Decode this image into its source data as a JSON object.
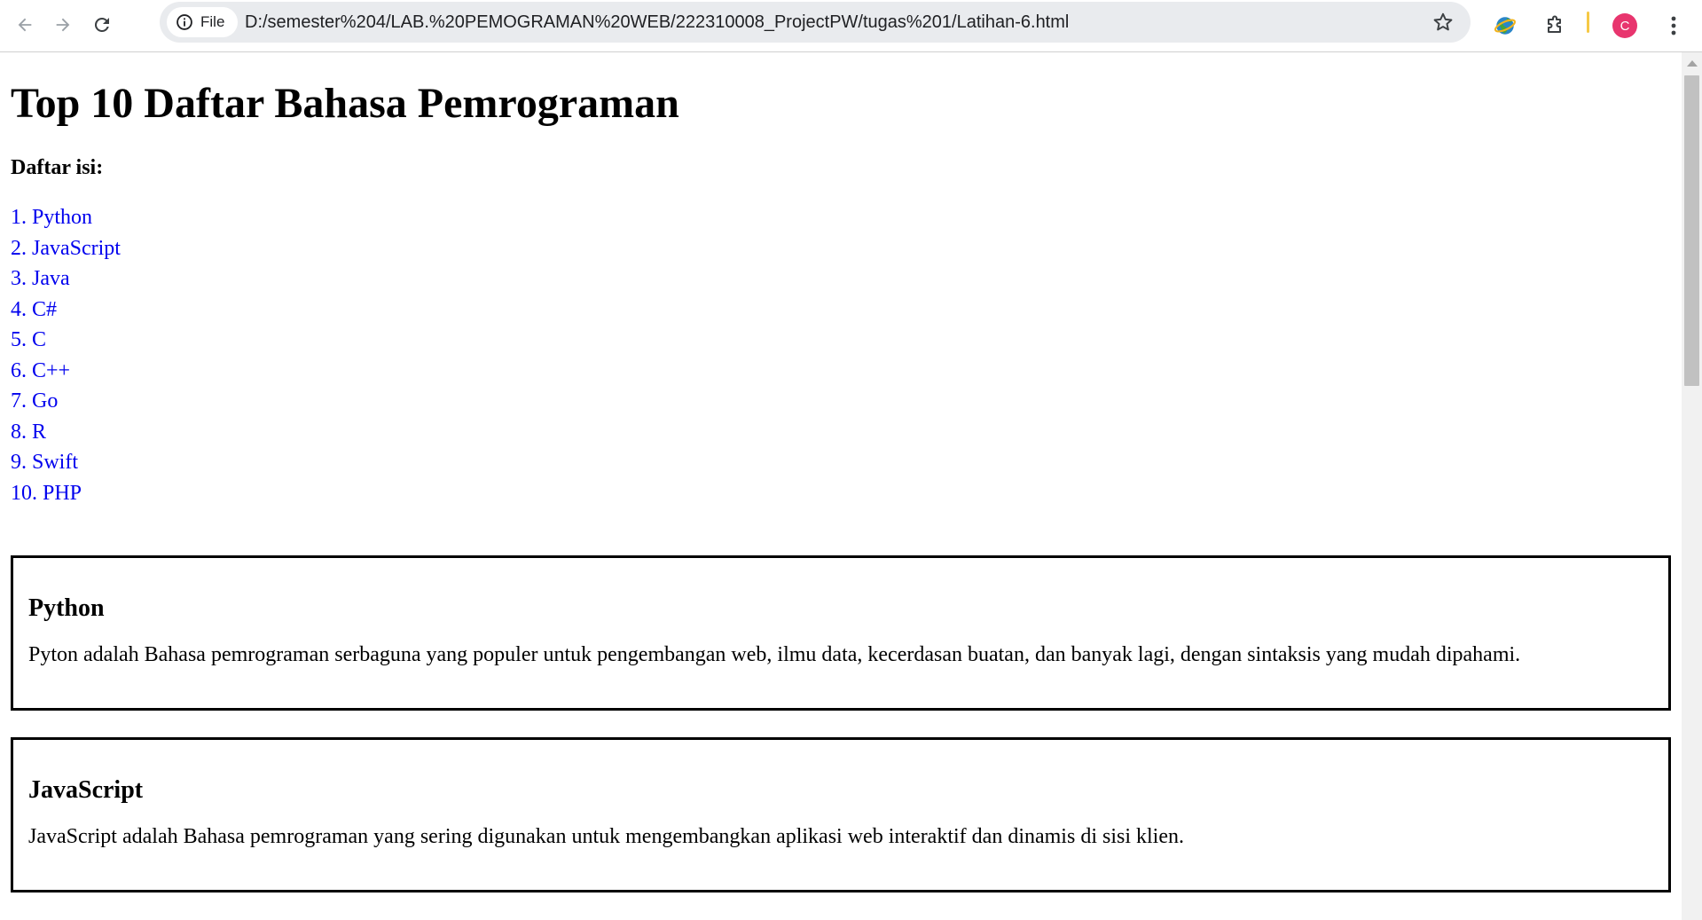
{
  "browser": {
    "file_chip_label": "File",
    "url": "D:/semester%204/LAB.%20PEMOGRAMAN%20WEB/222310008_ProjectPW/tugas%201/Latihan-6.html",
    "profile_initial": "C",
    "icons": [
      "back-arrow",
      "forward-arrow",
      "reload",
      "info",
      "star",
      "extension-globe",
      "puzzle-extensions",
      "kebab-menu"
    ],
    "colors": {
      "profile_avatar": "#e8356e",
      "link": "#0000ee"
    }
  },
  "page": {
    "title": "Top 10 Daftar Bahasa Pemrograman",
    "toc_heading": "Daftar isi:",
    "toc": [
      "1. Python",
      "2. JavaScript",
      "3. Java",
      "4. C#",
      "5. C",
      "6. C++",
      "7. Go",
      "8. R",
      "9. Swift",
      "10. PHP"
    ],
    "sections": [
      {
        "heading": "Python",
        "body": "Pyton adalah Bahasa pemrograman serbaguna yang populer untuk pengembangan web, ilmu data, kecerdasan buatan, dan banyak lagi, dengan sintaksis yang mudah dipahami."
      },
      {
        "heading": "JavaScript",
        "body": "JavaScript adalah Bahasa pemrograman yang sering digunakan untuk mengembangkan aplikasi web interaktif dan dinamis di sisi klien."
      }
    ]
  }
}
